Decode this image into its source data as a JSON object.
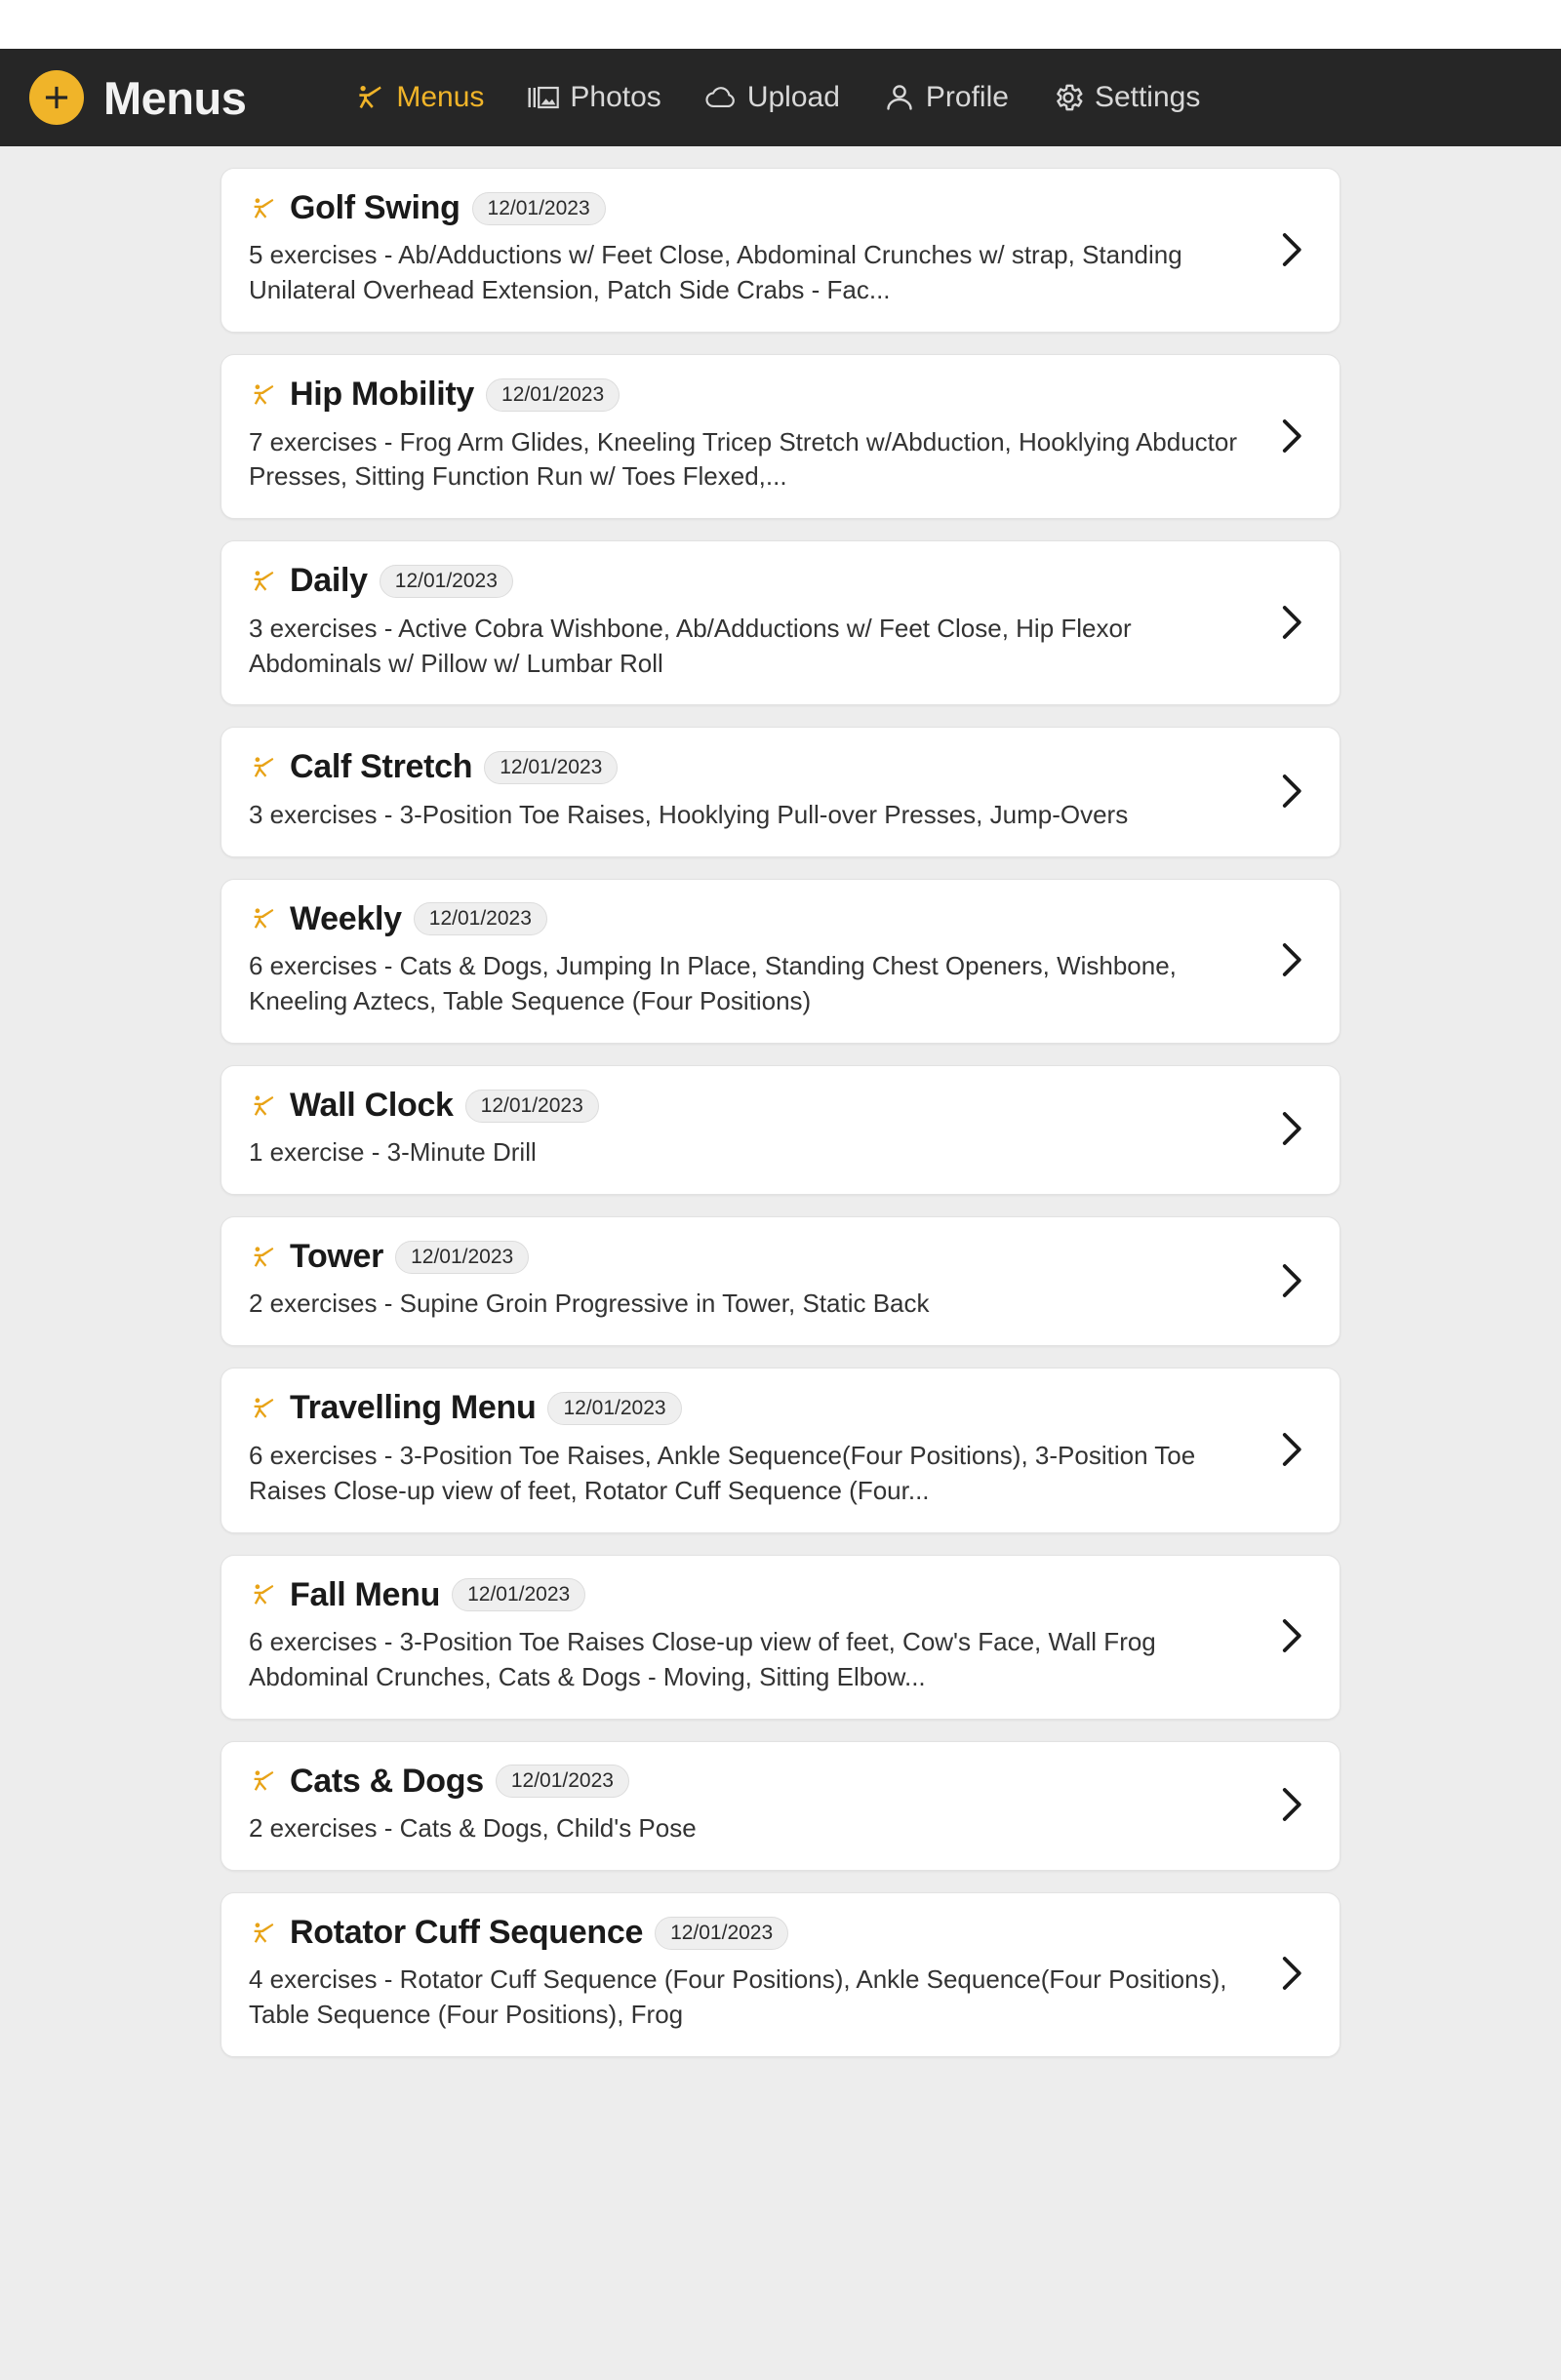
{
  "header": {
    "brand_title": "Menus",
    "brand_logo_icon": "plus-circle-icon",
    "nav": [
      {
        "label": "Menus",
        "icon": "exercise-person-icon",
        "active": true
      },
      {
        "label": "Photos",
        "icon": "photo-gallery-icon",
        "active": false
      },
      {
        "label": "Upload",
        "icon": "cloud-upload-icon",
        "active": false
      },
      {
        "label": "Profile",
        "icon": "person-icon",
        "active": false
      },
      {
        "label": "Settings",
        "icon": "gear-icon",
        "active": false
      }
    ]
  },
  "menus": [
    {
      "title": "Golf Swing",
      "date": "12/01/2023",
      "description": "5 exercises - Ab/Adductions w/ Feet Close, Abdominal Crunches w/ strap, Standing Unilateral Overhead Extension, Patch Side Crabs - Fac..."
    },
    {
      "title": "Hip Mobility",
      "date": "12/01/2023",
      "description": "7 exercises - Frog Arm Glides, Kneeling Tricep Stretch w/Abduction, Hooklying Abductor Presses, Sitting Function Run w/ Toes Flexed,..."
    },
    {
      "title": "Daily",
      "date": "12/01/2023",
      "description": "3 exercises - Active Cobra Wishbone, Ab/Adductions w/ Feet Close, Hip Flexor Abdominals w/ Pillow w/ Lumbar Roll"
    },
    {
      "title": "Calf Stretch",
      "date": "12/01/2023",
      "description": "3 exercises - 3-Position Toe Raises, Hooklying Pull-over Presses, Jump-Overs"
    },
    {
      "title": "Weekly",
      "date": "12/01/2023",
      "description": "6 exercises - Cats & Dogs, Jumping In Place, Standing Chest Openers, Wishbone, Kneeling Aztecs, Table Sequence (Four Positions)"
    },
    {
      "title": "Wall Clock",
      "date": "12/01/2023",
      "description": "1 exercise - 3-Minute Drill"
    },
    {
      "title": "Tower",
      "date": "12/01/2023",
      "description": "2 exercises - Supine Groin Progressive in Tower, Static Back"
    },
    {
      "title": "Travelling Menu",
      "date": "12/01/2023",
      "description": "6 exercises - 3-Position Toe Raises, Ankle Sequence(Four Positions), 3-Position Toe Raises Close-up view of feet, Rotator Cuff Sequence (Four..."
    },
    {
      "title": "Fall Menu",
      "date": "12/01/2023",
      "description": "6 exercises - 3-Position Toe Raises Close-up view of feet, Cow's Face, Wall Frog Abdominal Crunches, Cats & Dogs - Moving, Sitting Elbow..."
    },
    {
      "title": "Cats & Dogs",
      "date": "12/01/2023",
      "description": "2 exercises - Cats & Dogs, Child's Pose"
    },
    {
      "title": "Rotator Cuff Sequence",
      "date": "12/01/2023",
      "description": "4 exercises - Rotator Cuff Sequence (Four Positions), Ankle Sequence(Four Positions), Table Sequence (Four Positions), Frog"
    }
  ],
  "colors": {
    "accent": "#f0b429",
    "appbar_bg": "#262626",
    "page_bg": "#ededed",
    "card_bg": "#ffffff",
    "title_text": "#1a1a1a",
    "body_text": "#333333"
  },
  "icons": {
    "chevron": "chevron-right-icon",
    "menu_item": "exercise-person-icon"
  }
}
